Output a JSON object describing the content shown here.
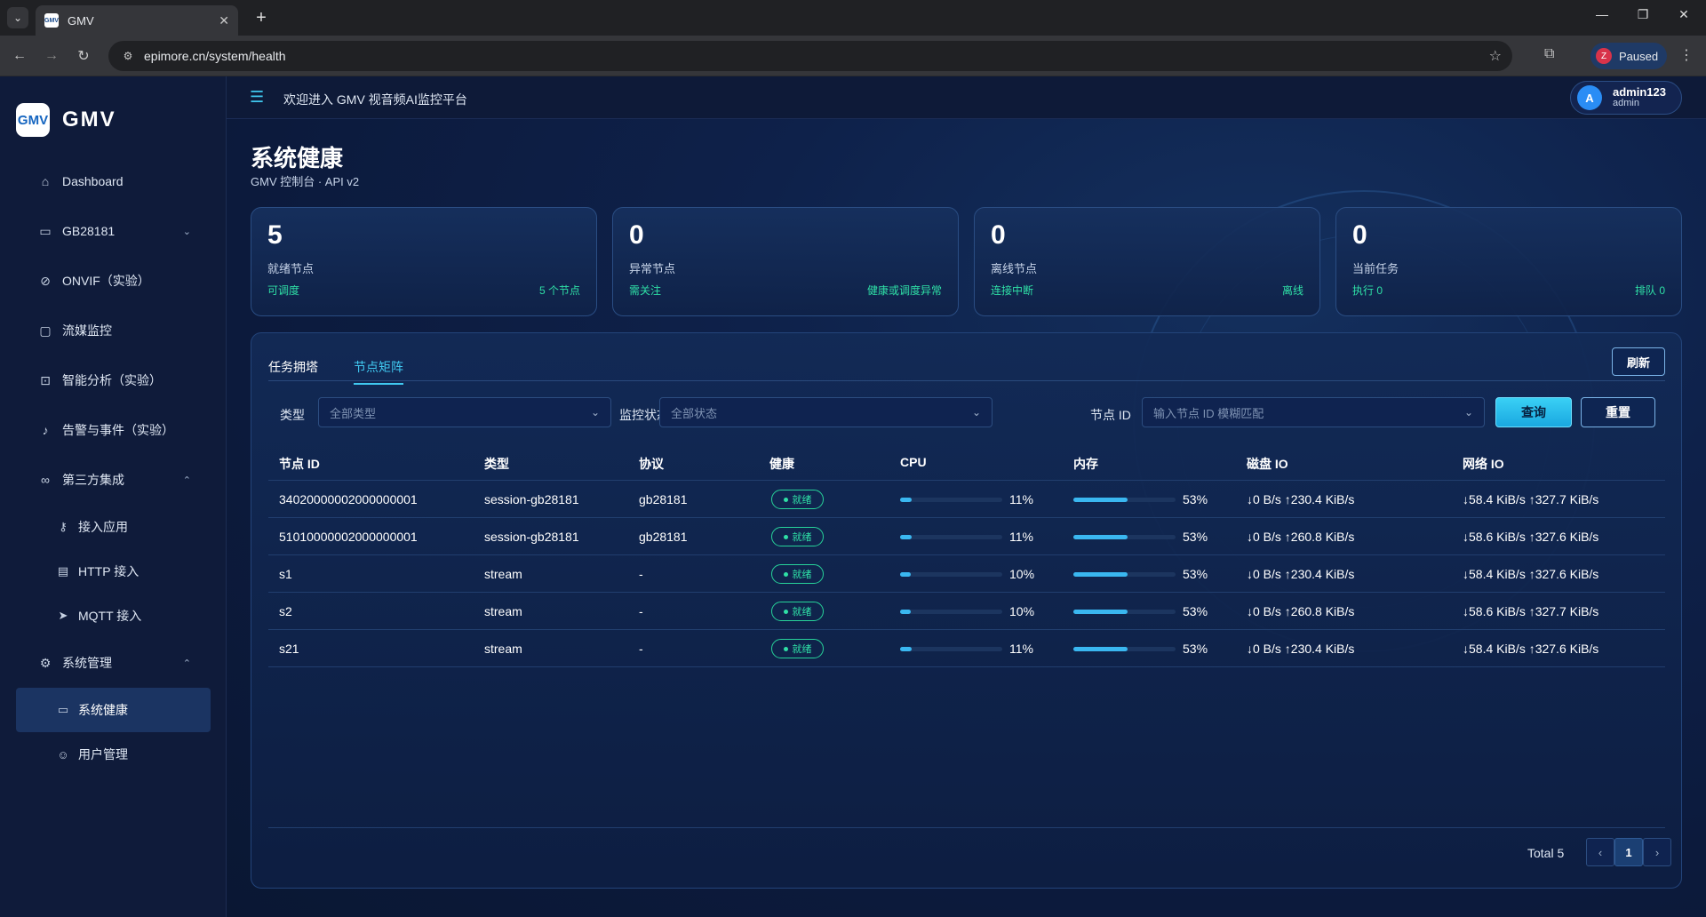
{
  "browser": {
    "tab_title": "GMV",
    "favicon_text": "GMV",
    "url": "epimore.cn/system/health",
    "profile_initial": "Z",
    "profile_status": "Paused"
  },
  "sidebar": {
    "logo_mark": "GMV",
    "logo_text": "GMV",
    "items": [
      {
        "label": "Dashboard",
        "icon": "home-icon"
      },
      {
        "label": "GB28181",
        "icon": "monitor-icon",
        "arrow": "⌄"
      },
      {
        "label": "ONVIF（实验）",
        "icon": "chain-icon"
      },
      {
        "label": "流媒监控",
        "icon": "camera-icon"
      },
      {
        "label": "智能分析（实验）",
        "icon": "analysis-icon"
      },
      {
        "label": "告警与事件（实验）",
        "icon": "bell-icon"
      },
      {
        "label": "第三方集成",
        "icon": "link-icon",
        "arrow": "⌃"
      },
      {
        "label": "接入应用",
        "icon": "key-icon"
      },
      {
        "label": "HTTP 接入",
        "icon": "document-icon"
      },
      {
        "label": "MQTT 接入",
        "icon": "send-icon"
      },
      {
        "label": "系统管理",
        "icon": "gear-icon",
        "arrow": "⌃"
      },
      {
        "label": "系统健康",
        "icon": "monitor-icon"
      },
      {
        "label": "用户管理",
        "icon": "user-icon"
      }
    ]
  },
  "header": {
    "welcome": "欢迎进入 GMV 视音频AI监控平台",
    "user_initial": "A",
    "user_name": "admin123",
    "user_role": "admin"
  },
  "page": {
    "title": "系统健康",
    "subtitle": "GMV 控制台 · API v2"
  },
  "stats": [
    {
      "value": "5",
      "label": "就绪节点",
      "left": "可调度",
      "right": "5 个节点"
    },
    {
      "value": "0",
      "label": "异常节点",
      "left": "需关注",
      "right": "健康或调度异常"
    },
    {
      "value": "0",
      "label": "离线节点",
      "left": "连接中断",
      "right": "离线"
    },
    {
      "value": "0",
      "label": "当前任务",
      "left": "执行 0",
      "right": "排队 0"
    }
  ],
  "tabs": [
    "任务拥塔",
    "节点矩阵"
  ],
  "active_tab": "节点矩阵",
  "refresh_label": "刷新",
  "filters": {
    "type_label": "类型",
    "type_placeholder": "全部类型",
    "status_label": "监控状态",
    "status_placeholder": "全部状态",
    "node_label": "节点 ID",
    "node_placeholder": "输入节点 ID 模糊匹配",
    "query_label": "查询",
    "reset_label": "重置"
  },
  "table": {
    "columns": [
      "节点 ID",
      "类型",
      "协议",
      "健康",
      "CPU",
      "内存",
      "磁盘 IO",
      "网络 IO"
    ],
    "rows": [
      {
        "id": "34020000002000000001",
        "type": "session-gb28181",
        "protocol": "gb28181",
        "health": "就绪",
        "cpu": 11,
        "cpu_text": "11%",
        "mem": 53,
        "mem_text": "53%",
        "disk": "↓0 B/s ↑230.4 KiB/s",
        "net": "↓58.4 KiB/s ↑327.7 KiB/s"
      },
      {
        "id": "51010000002000000001",
        "type": "session-gb28181",
        "protocol": "gb28181",
        "health": "就绪",
        "cpu": 11,
        "cpu_text": "11%",
        "mem": 53,
        "mem_text": "53%",
        "disk": "↓0 B/s ↑260.8 KiB/s",
        "net": "↓58.6 KiB/s ↑327.6 KiB/s"
      },
      {
        "id": "s1",
        "type": "stream",
        "protocol": "-",
        "health": "就绪",
        "cpu": 10,
        "cpu_text": "10%",
        "mem": 53,
        "mem_text": "53%",
        "disk": "↓0 B/s ↑230.4 KiB/s",
        "net": "↓58.4 KiB/s ↑327.6 KiB/s"
      },
      {
        "id": "s2",
        "type": "stream",
        "protocol": "-",
        "health": "就绪",
        "cpu": 10,
        "cpu_text": "10%",
        "mem": 53,
        "mem_text": "53%",
        "disk": "↓0 B/s ↑260.8 KiB/s",
        "net": "↓58.6 KiB/s ↑327.7 KiB/s"
      },
      {
        "id": "s21",
        "type": "stream",
        "protocol": "-",
        "health": "就绪",
        "cpu": 11,
        "cpu_text": "11%",
        "mem": 53,
        "mem_text": "53%",
        "disk": "↓0 B/s ↑230.4 KiB/s",
        "net": "↓58.4 KiB/s ↑327.6 KiB/s"
      }
    ]
  },
  "pagination": {
    "total_text": "Total 5",
    "current_page": "1",
    "prev": "‹",
    "next": "›"
  },
  "colors": {
    "accent": "#40c8f0",
    "success": "#2fe0a6",
    "background": "#0b1530"
  }
}
